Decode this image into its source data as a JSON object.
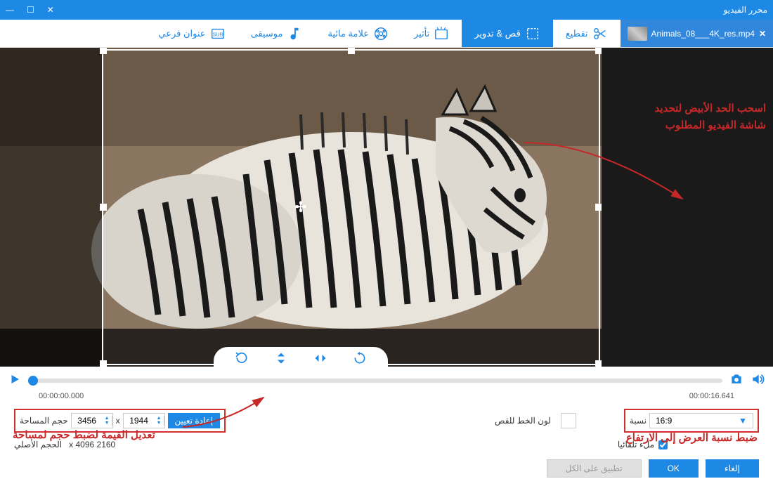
{
  "window": {
    "title": "محرر الفيديو"
  },
  "file_tab": {
    "name": "Animals_08___4K_res.mp4"
  },
  "tabs": [
    {
      "id": "cut",
      "label": "تقطيع"
    },
    {
      "id": "crop",
      "label": "قص & تدوير"
    },
    {
      "id": "effect",
      "label": "تأثير"
    },
    {
      "id": "watermark",
      "label": "علامة مائية"
    },
    {
      "id": "music",
      "label": "موسيقى"
    },
    {
      "id": "subtitle",
      "label": "عنوان فرعي"
    }
  ],
  "annotations": {
    "drag_border": "اسحب الحد الأبيض لتحديد\nشاشة الفيديو المطلوب",
    "adjust_value": "تعديل القيمة لضبط حجم لمساحة",
    "set_ratio": "ضبط نسبة العرض إلى الارتفاع"
  },
  "timeline": {
    "current": "00:00:00.000",
    "total": "00:00:16.641"
  },
  "settings": {
    "reset": "إعادة تعيين",
    "width": "1944",
    "x_sep": "x",
    "height": "3456",
    "area_label": "حجم المساحة",
    "crop_line_color": "لون الخط للقص",
    "ratio_label": "نسبة",
    "ratio_value": "16:9",
    "original_size": "2160 x 4096",
    "original_label": "الحجم الأصلي",
    "auto_fill": "ملء تلقائيا"
  },
  "footer": {
    "cancel": "إلغاء",
    "ok": "OK",
    "apply_all": "تطبيق على الكل"
  }
}
